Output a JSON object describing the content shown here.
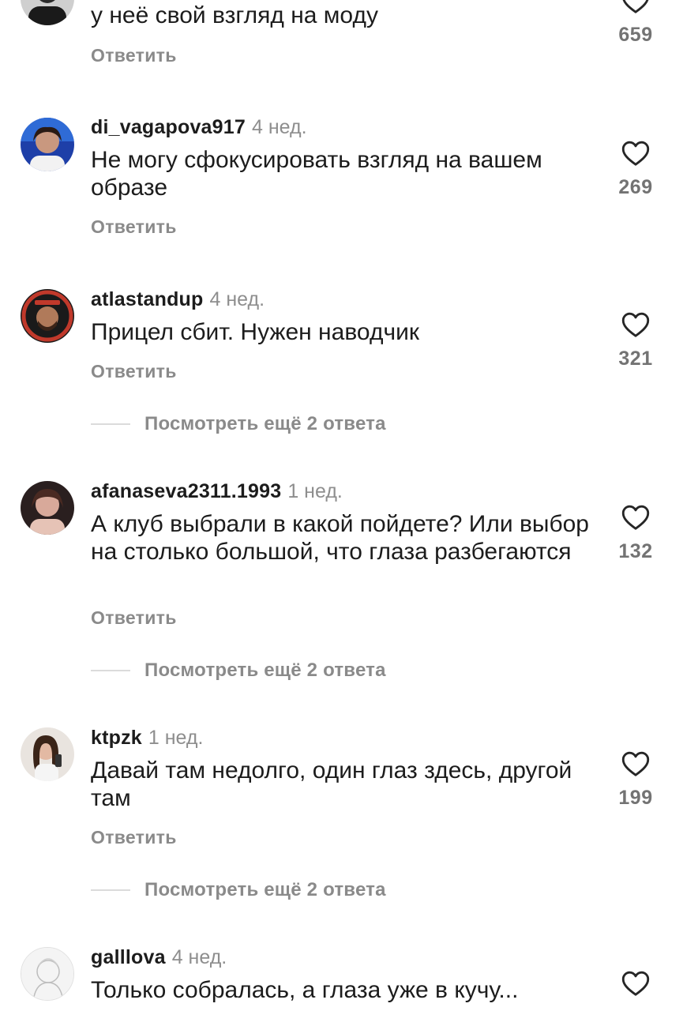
{
  "comments": [
    {
      "username": "",
      "time": "",
      "text": "у неё свой взгляд на моду",
      "reply_label": "Ответить",
      "likes": "659",
      "avatar_icon": "avatar-man-photo"
    },
    {
      "username": "di_vagapova917",
      "time": "4 нед.",
      "text": "Не могу сфокусировать взгляд на вашем образе",
      "reply_label": "Ответить",
      "likes": "269",
      "avatar_icon": "avatar-woman-blue-photo"
    },
    {
      "username": "atlastandup",
      "time": "4 нед.",
      "text": "Прицел сбит. Нужен наводчик",
      "reply_label": "Ответить",
      "likes": "321",
      "more_replies": "Посмотреть ещё 2 ответа",
      "avatar_icon": "avatar-logo-badge"
    },
    {
      "username": "afanaseva2311.1993",
      "time": "1 нед.",
      "text": "А клуб выбрали в какой пойдете? Или выбор на столько большой, что глаза разбегаются",
      "reply_label": "Ответить",
      "likes": "132",
      "more_replies": "Посмотреть ещё 2 ответа",
      "avatar_icon": "avatar-woman-dark-photo"
    },
    {
      "username": "ktpzk",
      "time": "1 нед.",
      "text": "Давай там недолго, один глаз здесь, другой там",
      "reply_label": "Ответить",
      "likes": "199",
      "more_replies": "Посмотреть ещё 2 ответа",
      "avatar_icon": "avatar-woman-selfie-photo"
    },
    {
      "username": "galllova",
      "time": "4 нед.",
      "text": "Только собралась, а глаза уже в кучу...",
      "reply_label": "",
      "likes": "",
      "avatar_icon": "avatar-sketch-photo"
    }
  ],
  "colors": {
    "text": "#1c1c1c",
    "secondary": "#8e8e8e",
    "divider": "#dbdbdb",
    "heart": "#262626"
  }
}
